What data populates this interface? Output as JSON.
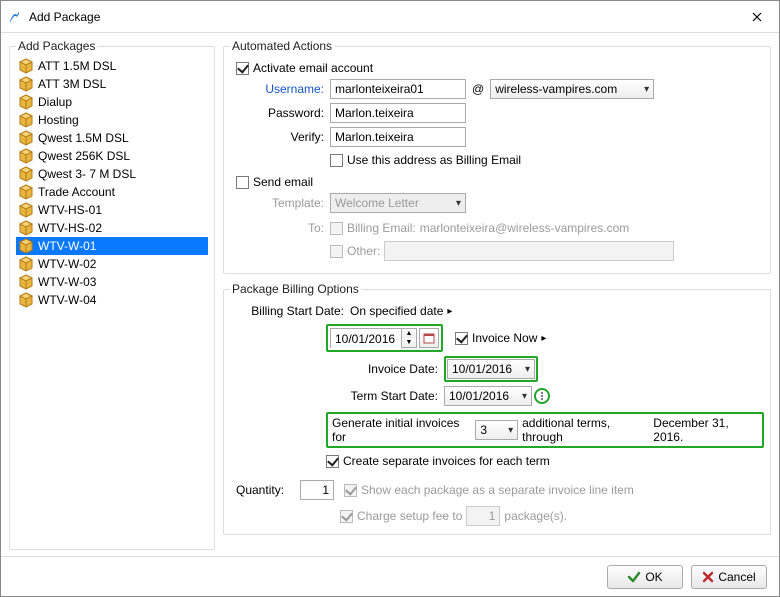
{
  "titlebar": {
    "title": "Add Package"
  },
  "left": {
    "legend": "Add Packages",
    "items": [
      {
        "label": "ATT 1.5M DSL"
      },
      {
        "label": "ATT 3M DSL"
      },
      {
        "label": "Dialup"
      },
      {
        "label": "Hosting"
      },
      {
        "label": "Qwest 1.5M DSL"
      },
      {
        "label": "Qwest 256K DSL"
      },
      {
        "label": "Qwest 3- 7 M DSL"
      },
      {
        "label": "Trade Account"
      },
      {
        "label": "WTV-HS-01"
      },
      {
        "label": "WTV-HS-02"
      },
      {
        "label": "WTV-W-01"
      },
      {
        "label": "WTV-W-02"
      },
      {
        "label": "WTV-W-03"
      },
      {
        "label": "WTV-W-04"
      }
    ],
    "selectedIndex": 10
  },
  "actions": {
    "legend": "Automated Actions",
    "activateEmail": "Activate email account",
    "usernameLabel": "Username:",
    "usernameValue": "marlonteixeira01",
    "atSign": "@",
    "domain": "wireless-vampires.com",
    "passwordLabel": "Password:",
    "passwordValue": "Marlon.teixeira",
    "verifyLabel": "Verify:",
    "verifyValue": "Marlon.teixeira",
    "useAsBilling": "Use this address as Billing Email",
    "sendEmail": "Send email",
    "templateLabel": "Template:",
    "templateValue": "Welcome Letter",
    "toLabel": "To:",
    "billingEmailLabel": "Billing Email:",
    "billingEmailValue": "marlonteixeira@wireless-vampires.com",
    "otherLabel": "Other:"
  },
  "billing": {
    "legend": "Package Billing Options",
    "startDateLabel": "Billing Start Date:",
    "startDateMode": "On specified date",
    "startDateValue": "10/01/2016",
    "invoiceNowLabel": "Invoice Now",
    "invoiceDateLabel": "Invoice Date:",
    "invoiceDateValue": "10/01/2016",
    "termStartLabel": "Term Start Date:",
    "termStartValue": "10/01/2016",
    "genInvoicesA": "Generate initial invoices for",
    "genInvoicesTerms": "3",
    "genInvoicesB": "additional terms, through",
    "genInvoicesThrough": "December 31, 2016.",
    "separateInvoices": "Create separate invoices for each term",
    "quantityLabel": "Quantity:",
    "quantityValue": "1",
    "showSeparate": "Show each package as a separate invoice line item",
    "chargeSetup": "Charge setup fee to",
    "chargeSetupN": "1",
    "chargeSetupTail": "package(s)."
  },
  "footer": {
    "ok": "OK",
    "cancel": "Cancel"
  }
}
